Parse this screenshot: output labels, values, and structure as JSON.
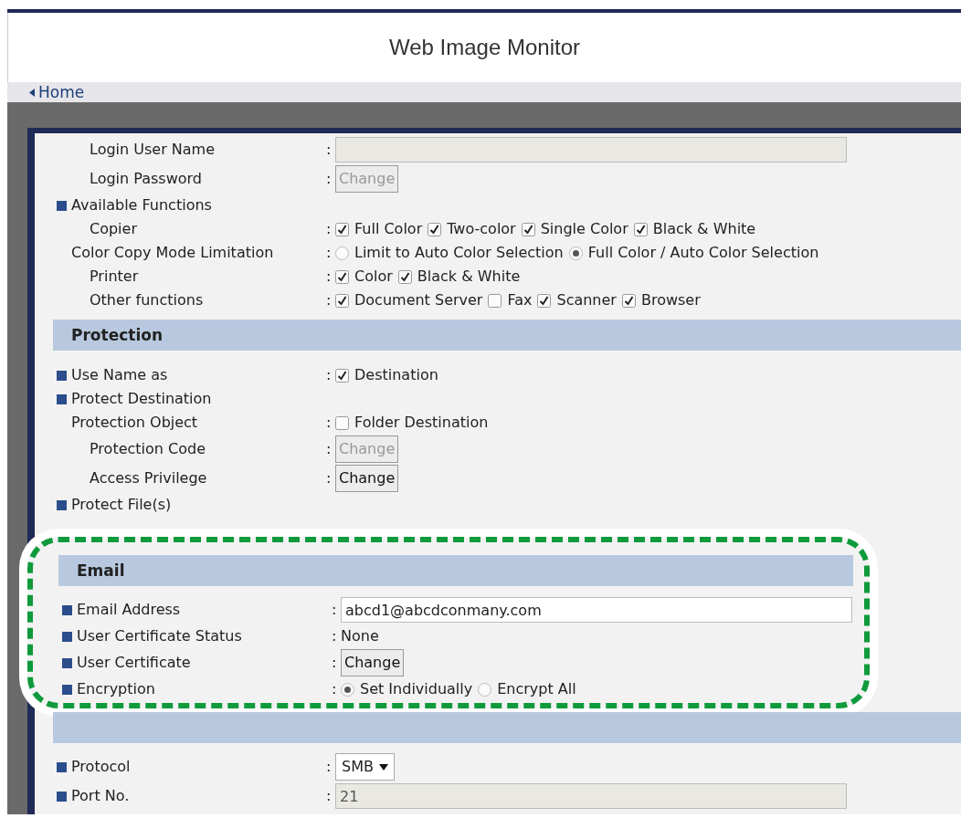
{
  "header": {
    "title": "Web Image Monitor"
  },
  "nav": {
    "back_link": "Home"
  },
  "sections": [
    {
      "kind": "plain",
      "items": [
        {
          "children": [
            {
              "label": "Login User Name",
              "sep": ":",
              "control": {
                "kind": "field",
                "disabled": true
              }
            },
            {
              "label": "Login Password",
              "sep": ":",
              "control": {
                "kind": "button",
                "label": "Change",
                "disabled": true
              }
            }
          ]
        },
        {
          "label": "Available Functions",
          "bullet": true,
          "children": [
            {
              "label": "Copier",
              "sep": ":",
              "control": {
                "kind": "checks",
                "options": [
                  {
                    "label": "Full Color",
                    "checked": true
                  },
                  {
                    "label": "Two-color",
                    "checked": true
                  },
                  {
                    "label": "Single Color",
                    "checked": true
                  },
                  {
                    "label": "Black & White",
                    "checked": true
                  }
                ]
              }
            }
          ]
        },
        {
          "label": "Color Copy Mode Limitation",
          "sep": ":",
          "control": {
            "kind": "radios",
            "options": [
              {
                "label": "Limit to Auto Color Selection",
                "selected": false
              },
              {
                "label": "Full Color / Auto Color Selection",
                "selected": true
              }
            ]
          }
        },
        {
          "children": [
            {
              "label": "Printer",
              "sep": ":",
              "control": {
                "kind": "checks",
                "options": [
                  {
                    "label": "Color",
                    "checked": true
                  },
                  {
                    "label": "Black & White",
                    "checked": true
                  }
                ]
              }
            },
            {
              "label": "Other functions",
              "sep": ":",
              "control": {
                "kind": "checks",
                "options": [
                  {
                    "label": "Document Server",
                    "checked": true
                  },
                  {
                    "label": "Fax",
                    "checked": false
                  },
                  {
                    "label": "Scanner",
                    "checked": true
                  },
                  {
                    "label": "Browser",
                    "checked": true
                  }
                ]
              }
            }
          ]
        }
      ]
    },
    {
      "kind": "band",
      "heading": "Protection",
      "items": [
        {
          "label": "Use Name as",
          "bullet": true,
          "sep": ":",
          "control": {
            "kind": "checks",
            "options": [
              {
                "label": "Destination",
                "checked": true
              }
            ]
          }
        },
        {
          "label": "Protect Destination",
          "bullet": true
        },
        {
          "label": "Protection Object",
          "sep": ":",
          "control": {
            "kind": "checks",
            "options": [
              {
                "label": "Folder Destination",
                "checked": false
              }
            ]
          },
          "children": [
            {
              "label": "Protection Code",
              "sep": ":",
              "control": {
                "kind": "button",
                "label": "Change",
                "disabled": true
              }
            },
            {
              "label": "Access Privilege",
              "sep": ":",
              "control": {
                "kind": "button",
                "label": "Change",
                "disabled": false
              }
            }
          ]
        },
        {
          "label": "Protect File(s)",
          "bullet": true
        }
      ]
    },
    {
      "kind": "band",
      "heading": "Email",
      "highlighted": true,
      "items": [
        {
          "label": "Email Address",
          "bullet": true,
          "sep": ":",
          "control": {
            "kind": "field",
            "value": "abcd1@abcdconmany.com",
            "disabled": false
          }
        },
        {
          "label": "User Certificate Status",
          "bullet": true,
          "sep": ":",
          "control": {
            "kind": "text",
            "value": "None"
          }
        },
        {
          "label": "User Certificate",
          "bullet": true,
          "sep": ":",
          "control": {
            "kind": "button",
            "label": "Change",
            "disabled": false
          }
        },
        {
          "label": "Encryption",
          "bullet": true,
          "sep": ":",
          "control": {
            "kind": "radios",
            "options": [
              {
                "label": "Set Individually",
                "selected": true
              },
              {
                "label": "Encrypt All",
                "selected": false
              }
            ]
          }
        }
      ]
    },
    {
      "kind": "band",
      "items": [
        {
          "label": "Protocol",
          "bullet": true,
          "sep": ":",
          "control": {
            "kind": "select",
            "value": "SMB"
          }
        },
        {
          "label": "Port No.",
          "bullet": true,
          "sep": ":",
          "control": {
            "kind": "field",
            "value": "21",
            "disabled": true
          }
        }
      ]
    }
  ]
}
